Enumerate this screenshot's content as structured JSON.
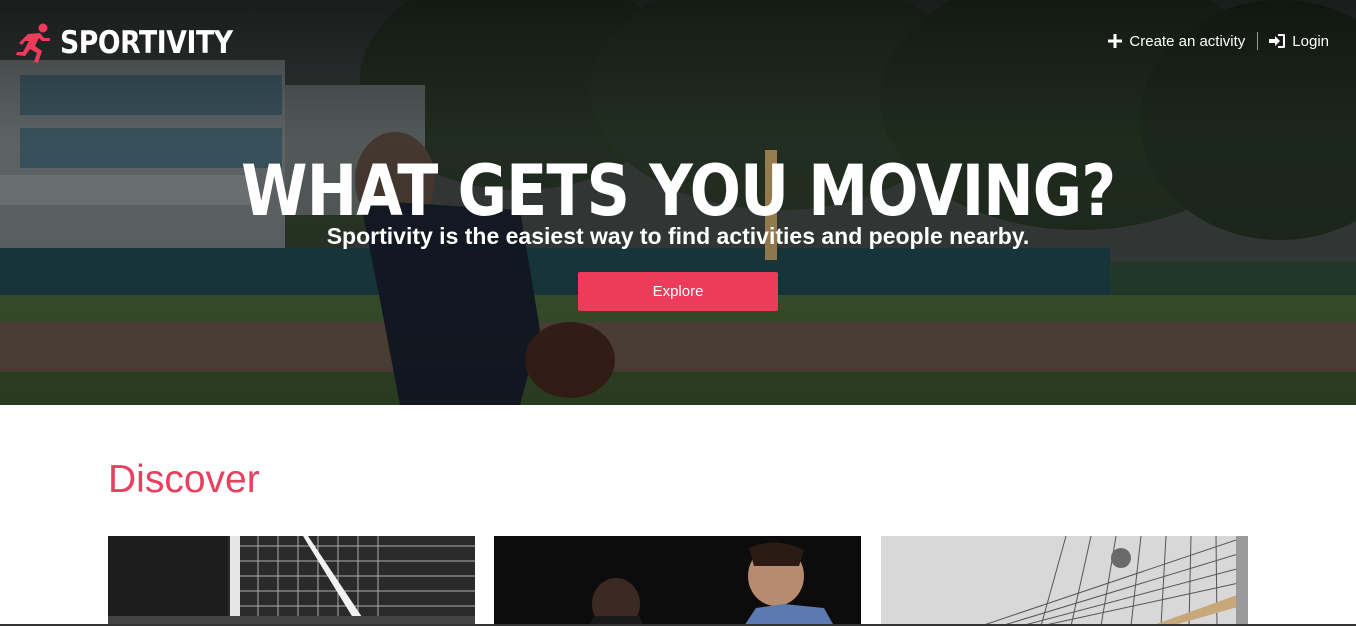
{
  "brand": {
    "name": "SPORTIVITY",
    "icon": "runner-icon",
    "accent_color": "#ec3b5b"
  },
  "nav": {
    "create_activity": {
      "label": "Create an activity",
      "icon": "plus-icon"
    },
    "login": {
      "label": "Login",
      "icon": "sign-in-icon"
    }
  },
  "hero": {
    "headline": "WHAT GETS YOU MOVING?",
    "tagline": "Sportivity is the easiest way to find activities and people nearby.",
    "explore_label": "Explore",
    "background": "baseball-pitcher-photo"
  },
  "discover": {
    "title": "Discover",
    "title_color": "#e8405f",
    "cards": [
      {
        "image": "soccer-goal-net-photo"
      },
      {
        "image": "basketball-players-photo"
      },
      {
        "image": "volleyball-net-photo"
      }
    ]
  }
}
